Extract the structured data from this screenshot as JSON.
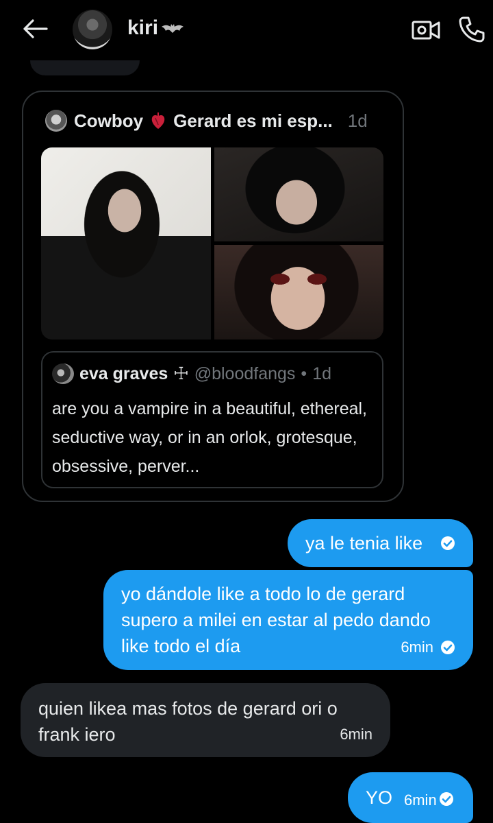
{
  "header": {
    "contact_name": "kiri",
    "icons": [
      "back-arrow-icon",
      "bat-icon",
      "video-call-icon",
      "phone-icon"
    ]
  },
  "shared_post": {
    "author": "Cowboy",
    "title": "Gerard es mi esp...",
    "time": "1d",
    "quoted": {
      "author": "eva graves",
      "cross": "☩",
      "handle": "@bloodfangs",
      "separator": "•",
      "time": "1d",
      "text": "are you a vampire in a beautiful, ethereal, seductive way, or in an orlok, grotesque, obsessive, perver..."
    }
  },
  "messages": [
    {
      "direction": "out",
      "text": "ya le tenia like",
      "time": ""
    },
    {
      "direction": "out",
      "text": "yo dándole like a todo lo de gerard supero a milei en estar al pedo dando like todo el día",
      "time": "6min"
    },
    {
      "direction": "in",
      "text": "quien likea mas fotos de gerard ori o frank iero",
      "time": "6min"
    },
    {
      "direction": "out",
      "text": "YO",
      "time": "6min"
    }
  ],
  "colors": {
    "background": "#000000",
    "outgoing_bubble": "#1d9bf0",
    "incoming_bubble": "#202327",
    "secondary_text": "#71767b"
  }
}
